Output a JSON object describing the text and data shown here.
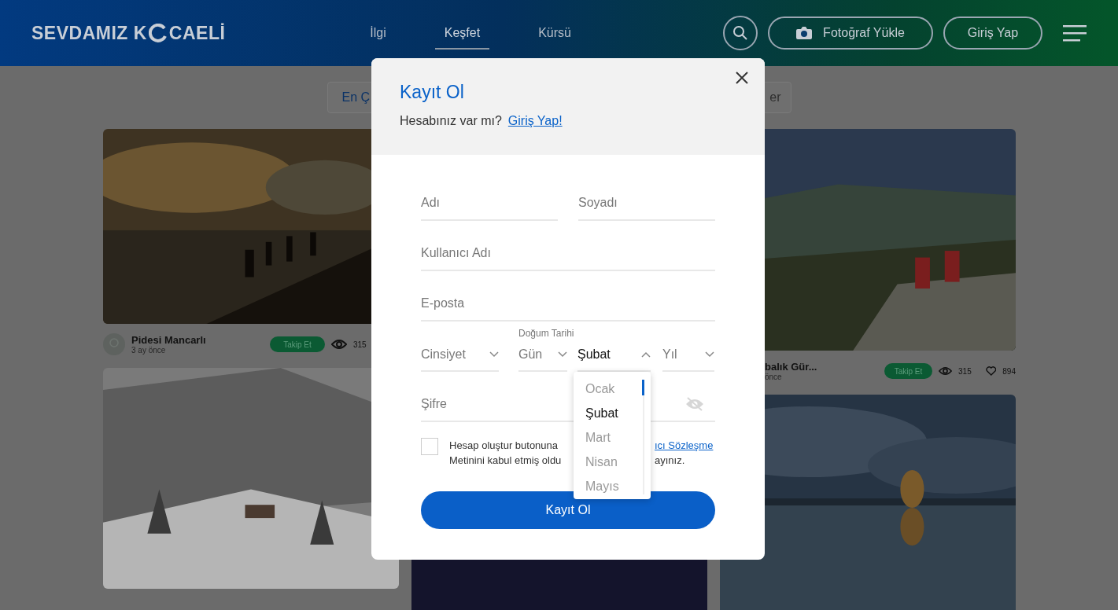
{
  "header": {
    "logo_left": "SEVDAMIZ K",
    "logo_right": "CAELİ",
    "nav": [
      {
        "label": "İlgi",
        "selected": false
      },
      {
        "label": "Keşfet",
        "selected": true
      },
      {
        "label": "Kürsü",
        "selected": false
      }
    ],
    "upload_button": "Fotoğraf Yükle",
    "login_button": "Giriş Yap"
  },
  "sort_bar": {
    "left_button": "En Ç",
    "right_button": "er"
  },
  "feed": {
    "columns": [
      [
        {
          "kind": "post",
          "author": "Pidesi Mancarlı",
          "time": "3 ay önce",
          "follow": "Takip Et",
          "views": "315"
        },
        {
          "kind": "picture"
        }
      ],
      [
        {
          "kind": "picture"
        }
      ],
      [
        {
          "kind": "partial",
          "author": "balık Gür...",
          "time": "önce",
          "follow": "Takip Et",
          "views": "315",
          "likes": "894"
        },
        {
          "kind": "picture"
        }
      ]
    ]
  },
  "modal": {
    "title": "Kayıt Ol",
    "prompt": "Hesabınız var mı?",
    "login_link": "Giriş Yap!",
    "name": {
      "placeholder": "Adı"
    },
    "surname": {
      "placeholder": "Soyadı"
    },
    "username": {
      "placeholder": "Kullanıcı Adı"
    },
    "email": {
      "placeholder": "E-posta"
    },
    "gender": {
      "placeholder": "Cinsiyet",
      "expanded": false
    },
    "birth_label": "Doğum Tarihi",
    "day": {
      "placeholder": "Gün",
      "expanded": false
    },
    "month": {
      "value": "Şubat",
      "expanded": true,
      "options": [
        {
          "label": "Ocak",
          "selected": false
        },
        {
          "label": "Şubat",
          "selected": true
        },
        {
          "label": "Mart",
          "selected": false
        },
        {
          "label": "Nisan",
          "selected": false
        },
        {
          "label": "Mayıs",
          "selected": false
        }
      ]
    },
    "year": {
      "placeholder": "Yıl",
      "expanded": false
    },
    "password": {
      "placeholder": "Şifre"
    },
    "consent": {
      "checked": false,
      "line1_left": "Hesap oluştur butonuna",
      "line1_link": "ıcı Sözleşme",
      "line2_left": "Metinini kabul etmiş oldu",
      "line2_right": "ayınız."
    },
    "submit": "Kayıt Ol"
  }
}
